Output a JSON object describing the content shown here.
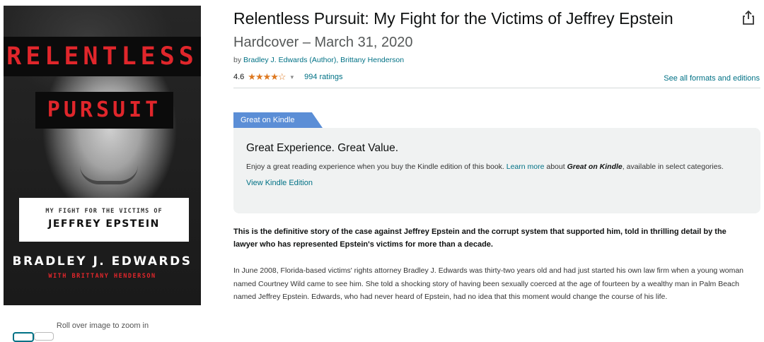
{
  "cover": {
    "title_line1": "RELENTLESS",
    "title_line2": "PURSUIT",
    "subtitle_line1": "MY FIGHT FOR THE VICTIMS OF",
    "subtitle_line2": "JEFFREY EPSTEIN",
    "author": "BRADLEY J. EDWARDS",
    "coauthor": "WITH BRITTANY HENDERSON"
  },
  "zoom_hint": "Roll over image to zoom in",
  "product": {
    "title": "Relentless Pursuit: My Fight for the Victims of Jeffrey Epstein",
    "binding_date": "Hardcover – March 31, 2020",
    "by_prefix": "by",
    "author_1": "Bradley J. Edwards (Author),",
    "author_2": "Brittany Henderson",
    "rating_value": "4.6",
    "stars": "★★★★☆",
    "ratings_count": "994 ratings",
    "formats_link": "See all formats and editions"
  },
  "kindle": {
    "tag": "Great on Kindle",
    "heading": "Great Experience. Great Value.",
    "text_1": "Enjoy a great reading experience when you buy the Kindle edition of this book.",
    "learn_more": "Learn more",
    "text_2": "about",
    "great_on_kindle": "Great on Kindle",
    "text_3": ", available in select categories.",
    "view_link": "View Kindle Edition"
  },
  "description": {
    "lead": "This is the definitive story of the case against Jeffrey Epstein and the corrupt system that supported him, told in thrilling detail by the lawyer who has represented Epstein's victims for more than a decade.",
    "body": "In June 2008, Florida-based victims' rights attorney Bradley J. Edwards was thirty-two years old and had just started his own law firm when a young woman named Courtney Wild came to see him. She told a shocking story of having been sexually coerced at the age of fourteen by a wealthy man in Palm Beach named Jeffrey Epstein. Edwards, who had never heard of Epstein, had no idea that this moment would change the course of his life."
  },
  "colors": {
    "link": "#007185",
    "star": "#de7921",
    "kindle_tag": "#5b8ed6",
    "cover_red": "#e0262b"
  },
  "icons": {
    "share": "share-icon",
    "caret": "chevron-down-icon"
  }
}
